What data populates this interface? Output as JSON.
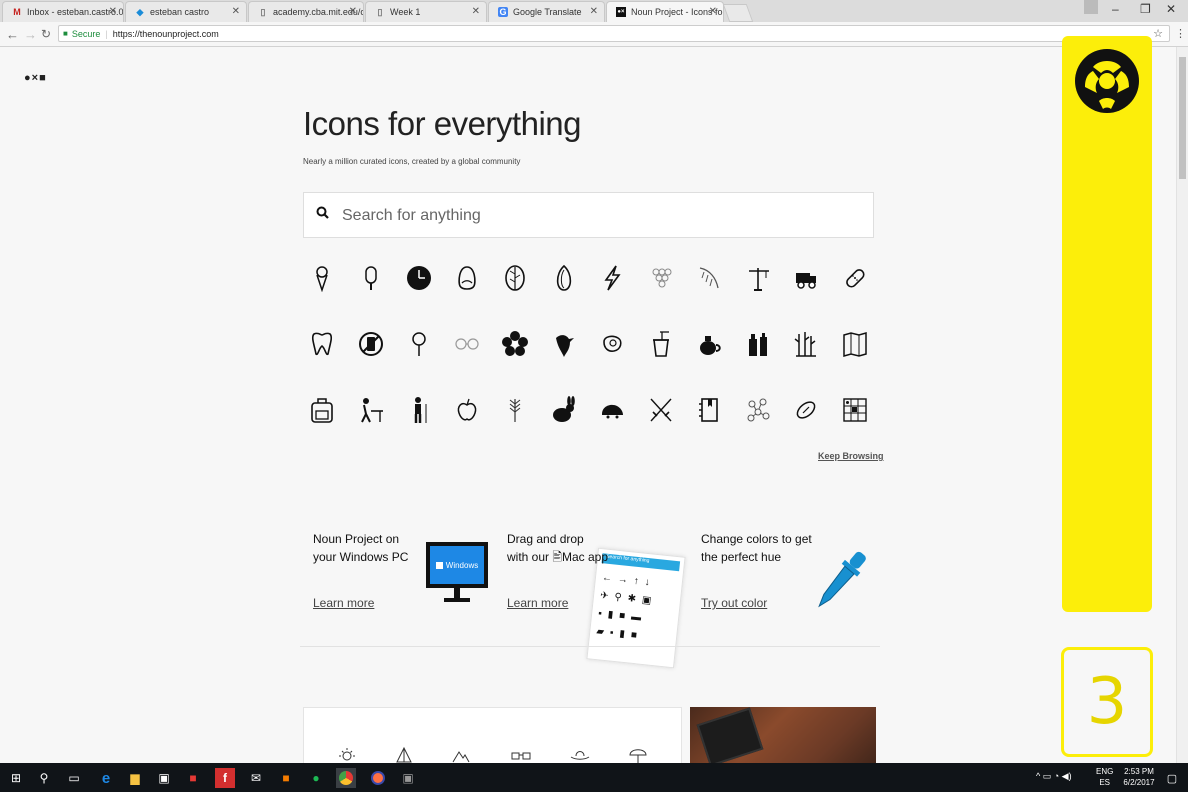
{
  "browser": {
    "tabs": [
      {
        "title": "Inbox - esteban.castro.0",
        "favicon": "M",
        "fav_color": "#c5221f"
      },
      {
        "title": "esteban castro",
        "favicon": "◆",
        "fav_color": "#1a8cd8"
      },
      {
        "title": "academy.cba.mit.edu/cla",
        "favicon": "▯",
        "fav_color": "#777777"
      },
      {
        "title": "Week 1",
        "favicon": "▯",
        "fav_color": "#777777"
      },
      {
        "title": "Google Translate",
        "favicon": "G",
        "fav_color": "#4285f4"
      },
      {
        "title": "Noun Project - Icons for",
        "favicon": "●×",
        "fav_color": "#111111"
      }
    ],
    "secure_label": "Secure",
    "url": "https://thenounproject.com"
  },
  "page": {
    "logo": "●×■",
    "title": "Icons for everything",
    "subtitle": "Nearly a million curated icons, created by a global community",
    "search_placeholder": "Search for anything",
    "icon_rows": [
      [
        "ice-cream-icon",
        "popsicle-icon",
        "clock-icon",
        "egg-icon",
        "leaf-icon",
        "almond-icon",
        "lightning-icon",
        "grapes-icon",
        "feather-icon",
        "crane-icon",
        "dump-truck-icon",
        "bandage-icon"
      ],
      [
        "tooth-icon",
        "no-phone-icon",
        "lollipop-icon",
        "glasses-icon",
        "flower-icon",
        "bird-icon",
        "steak-icon",
        "noodle-cup-icon",
        "teapot-icon",
        "bottles-icon",
        "reeds-icon",
        "map-icon"
      ],
      [
        "backpack-icon",
        "desk-worker-icon",
        "hiker-icon",
        "apple-icon",
        "wheat-icon",
        "rabbit-icon",
        "hedgehog-icon",
        "swords-icon",
        "notebook-icon",
        "molecule-icon",
        "football-icon",
        "grid-puzzle-icon"
      ]
    ],
    "keep_browsing": "Keep Browsing",
    "promos": [
      {
        "title_line1": "Noun Project on",
        "title_line2": "your Windows PC",
        "link": "Learn more",
        "badge": "Windows"
      },
      {
        "title_line1": "Drag and drop",
        "title_line2": "with our 🖹Mac app",
        "link": "Learn more",
        "mini_search": "Search for anything"
      },
      {
        "title_line1": "Change colors to get",
        "title_line2": "the perfect hue",
        "link": "Try out color"
      }
    ]
  },
  "overlay": {
    "number": "3",
    "color": "#fcee0a"
  },
  "taskbar": {
    "lang": "ENG",
    "locale": "ES",
    "time": "2:53 PM",
    "date": "6/2/2017"
  }
}
